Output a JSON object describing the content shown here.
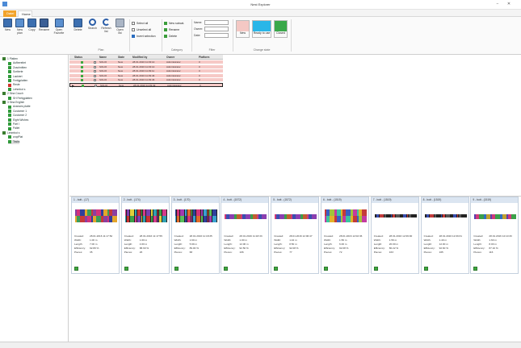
{
  "window": {
    "title": "Nest Explorer",
    "minimize": "−",
    "close": "✕"
  },
  "tabs": {
    "file": "Datei",
    "home": "Home"
  },
  "ribbon": {
    "buttons": [
      {
        "label": "New",
        "icon": "new-plan-icon"
      },
      {
        "label": "New plan",
        "icon": "new-plan-copy-icon"
      },
      {
        "label": "Copy",
        "icon": "copy-icon"
      },
      {
        "label": "Rename",
        "icon": "rename-icon"
      },
      {
        "label": "Open Favorite",
        "icon": "open-favorite-icon"
      },
      {
        "label": "Delete",
        "icon": "delete-icon"
      },
      {
        "label": "Search",
        "icon": "search-icon"
      },
      {
        "label": "Refresh list",
        "icon": "refresh-icon"
      },
      {
        "label": "Open list",
        "icon": "trash-icon"
      }
    ],
    "group_plan": "Plan",
    "select_all": "Select all",
    "unselect_all": "Unselect all",
    "invert_selection": "Invert selection",
    "new_subcat": "New subcat.",
    "rename": "Rename",
    "delete": "Delete",
    "group_category": "Category",
    "filter_name": "Name:",
    "filter_owner": "Owner:",
    "filter_date": "Date:",
    "group_filter": "Filter",
    "state_new": "New",
    "state_ready": "Ready to use",
    "state_closed": "Closed",
    "group_state": "Change state",
    "state_colors": {
      "new": "#f4c8c4",
      "ready": "#29b6e8",
      "closed": "#3aa84a"
    }
  },
  "tree": [
    {
      "label": "1 Platten",
      "level": 0
    },
    {
      "label": "Aufbereitet",
      "level": 1
    },
    {
      "label": "Zuschnitten",
      "level": 1
    },
    {
      "label": "Sortierte",
      "level": 1
    },
    {
      "label": "Lackiert",
      "level": 1
    },
    {
      "label": "Fertigplatten",
      "level": 1
    },
    {
      "label": "Reste",
      "level": 1,
      "red": true
    },
    {
      "label": "Lehmbot s",
      "level": 1
    },
    {
      "label": "2 Sina Couch",
      "level": 0
    },
    {
      "label": "SH Fertigplatten",
      "level": 1
    },
    {
      "label": "3 Sina English",
      "level": 0
    },
    {
      "label": "Avances platte",
      "level": 1
    },
    {
      "label": "Customer 1",
      "level": 1
    },
    {
      "label": "Customer 2",
      "level": 1
    },
    {
      "label": "Eight Wishes",
      "level": 1
    },
    {
      "label": "Part I",
      "level": 1
    },
    {
      "label": "Pallet",
      "level": 1
    },
    {
      "label": "Lehmbot s",
      "level": 0
    },
    {
      "label": "cropPlat",
      "level": 1
    },
    {
      "label": "Tasks",
      "level": 1,
      "selected": true
    }
  ],
  "grid": {
    "headers": [
      "Status",
      "Name",
      "State",
      "Modified by",
      "Owner",
      "Platform"
    ],
    "rows": [
      {
        "name": "SOLOI",
        "state": "New",
        "modified": "28.01.2016 11:33:14",
        "owner": "Administrator",
        "platform": "3"
      },
      {
        "name": "SOLOI",
        "state": "New",
        "modified": "28.01.2016 11:33:14",
        "owner": "Administrator",
        "platform": "3"
      },
      {
        "name": "SOLOI",
        "state": "New",
        "modified": "28.01.2016 11:39:11",
        "owner": "Administrator",
        "platform": "3"
      },
      {
        "name": "SOLOI",
        "state": "New",
        "modified": "28.01.2016 11:39:46",
        "owner": "Administrator",
        "platform": "3"
      },
      {
        "name": "SOLOI",
        "state": "New",
        "modified": "28.01.2016 11:39:46",
        "owner": "Administrator",
        "platform": "3"
      },
      {
        "name": "SOLOI",
        "state": "New",
        "modified": "28.01.2016 11:39:49",
        "owner": "Administrator",
        "platform": "3"
      }
    ]
  },
  "cards": [
    {
      "header": "1 - bott - (17)",
      "created": "28.01.2016 11:17:52",
      "width": "1.00 m",
      "length": "7.00 m",
      "efficiency": "92.89 %",
      "pieces": "35",
      "style": "mosaic-a"
    },
    {
      "header": "2 - bott - (174)",
      "created": "28.01.2016 11:17:55",
      "width": "1.60 m",
      "length": "4.60 m",
      "efficiency": "88.60 %",
      "pieces": "26",
      "style": "mosaic-b"
    },
    {
      "header": "3 - bott - (170)",
      "created": "28.01.2016 11:18:35",
      "width": "1.60 m",
      "length": "5.99 m",
      "efficiency": "89.00 %",
      "pieces": "68",
      "style": "mosaic-c"
    },
    {
      "header": "4 - bott - (1572)",
      "created": "28.01.2016 11:18:33",
      "width": "1.00 m",
      "length": "12.00 m",
      "efficiency": "92.50 %",
      "pieces": "106",
      "style": "strip"
    },
    {
      "header": "5 - bott - (1572)",
      "created": "28.01.2016 12:00:47",
      "width": "1.42 m",
      "length": "8.50 m",
      "efficiency": "92.08 %",
      "pieces": "77",
      "style": "strip"
    },
    {
      "header": "6 - bott - (1519)",
      "created": "28.01.2016 12:02:36",
      "width": "1.56 m",
      "length": "6.00 m",
      "efficiency": "92.08 %",
      "pieces": "72",
      "style": "mosaic-d"
    },
    {
      "header": "7 - bott - (1519)",
      "created": "28.01.2016 12:09:00",
      "width": "1.56 m",
      "length": "20.00 m",
      "efficiency": "80.22 %",
      "pieces": "163",
      "style": "thin"
    },
    {
      "header": "8 - bott - (1519)",
      "created": "28.01.2016 12:09:31",
      "width": "1.40 m",
      "length": "12.00 m",
      "efficiency": "92.60 %",
      "pieces": "165",
      "style": "thin"
    },
    {
      "header": "9 - bott - (1519)",
      "created": "28.01.2016 12:10:33",
      "width": "1.60 m",
      "length": "8.00 m",
      "efficiency": "87.10 %",
      "pieces": "116",
      "style": "strip2"
    }
  ],
  "card_labels": {
    "created": "Created:",
    "width": "Width:",
    "length": "Length:",
    "efficiency": "Efficiency:",
    "pieces": "Pieces:"
  }
}
